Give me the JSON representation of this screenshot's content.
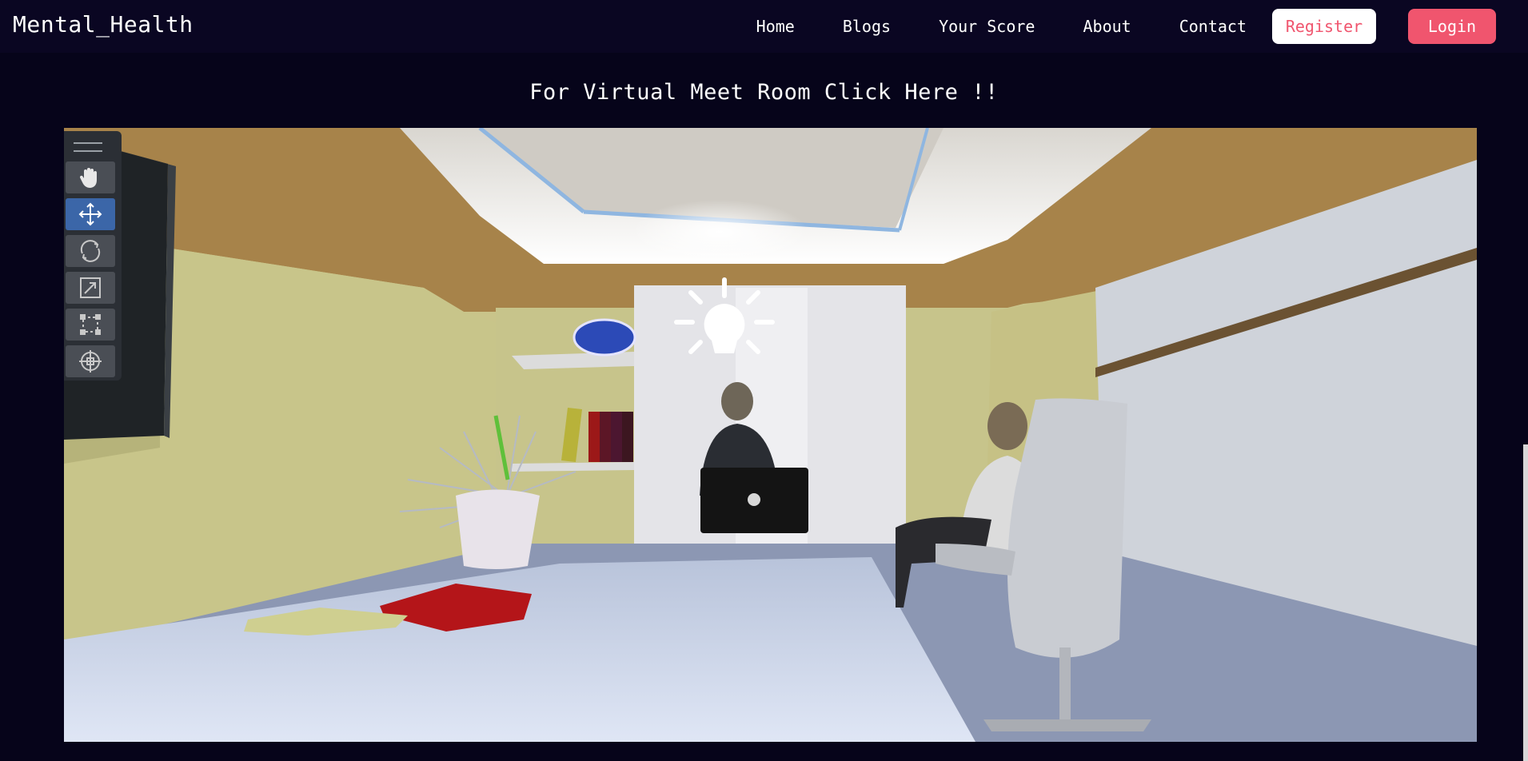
{
  "brand": "Mental_Health",
  "nav": {
    "home": "Home",
    "blogs": "Blogs",
    "score": "Your Score",
    "about": "About",
    "contact": "Contact",
    "register": "Register",
    "login": "Login"
  },
  "meet_link": "For Virtual Meet Room Click Here !!",
  "colors": {
    "accent": "#f0556e",
    "background": "#06041a",
    "navbar": "#0a0622",
    "tool_active": "#3b66a8"
  },
  "toolbar": {
    "tools": [
      "hand-icon",
      "move-icon",
      "rotate-icon",
      "scale-icon",
      "rect-icon",
      "transform-icon"
    ],
    "active_tool": "move-icon"
  }
}
